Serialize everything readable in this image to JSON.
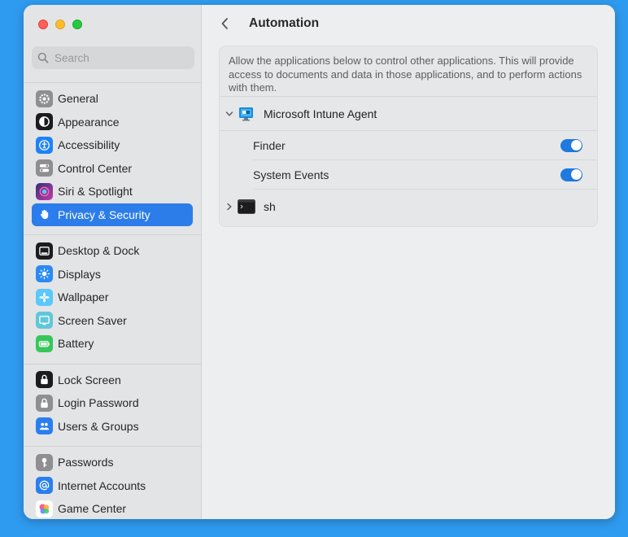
{
  "window": {
    "title": "Automation"
  },
  "search": {
    "placeholder": "Search"
  },
  "sidebar": {
    "groups": [
      [
        {
          "label": "General",
          "icon": "gear-icon",
          "color": "#8e8e93"
        },
        {
          "label": "Appearance",
          "icon": "appearance-icon",
          "color": "#1c1c1e"
        },
        {
          "label": "Accessibility",
          "icon": "accessibility-icon",
          "color": "#1e82f7"
        },
        {
          "label": "Control Center",
          "icon": "control-center-icon",
          "color": "#8e8e93"
        },
        {
          "label": "Siri & Spotlight",
          "icon": "siri-icon",
          "color": "#7a3cd6"
        },
        {
          "label": "Privacy & Security",
          "icon": "hand-icon",
          "color": "#2b7ef0",
          "active": true
        }
      ],
      [
        {
          "label": "Desktop & Dock",
          "icon": "dock-icon",
          "color": "#1c1c1e"
        },
        {
          "label": "Displays",
          "icon": "sun-icon",
          "color": "#2a8af5"
        },
        {
          "label": "Wallpaper",
          "icon": "wallpaper-icon",
          "color": "#5ac8fa"
        },
        {
          "label": "Screen Saver",
          "icon": "screen-saver-icon",
          "color": "#5fc7d9"
        },
        {
          "label": "Battery",
          "icon": "battery-icon",
          "color": "#35c759"
        }
      ],
      [
        {
          "label": "Lock Screen",
          "icon": "lock-icon",
          "color": "#1c1c1e"
        },
        {
          "label": "Login Password",
          "icon": "padlock-icon",
          "color": "#8e8e93"
        },
        {
          "label": "Users & Groups",
          "icon": "users-icon",
          "color": "#2a7ff0"
        }
      ],
      [
        {
          "label": "Passwords",
          "icon": "key-icon",
          "color": "#8e8e93"
        },
        {
          "label": "Internet Accounts",
          "icon": "at-icon",
          "color": "#2a7ff0"
        },
        {
          "label": "Game Center",
          "icon": "game-center-icon",
          "color": "#ffffff"
        }
      ]
    ]
  },
  "content": {
    "back": "<",
    "description": "Allow the applications below to control other applications. This will provide access to documents and data in those applications, and to perform actions with them.",
    "apps": [
      {
        "name": "Microsoft Intune Agent",
        "expanded": true,
        "targets": [
          {
            "label": "Finder",
            "enabled": true
          },
          {
            "label": "System Events",
            "enabled": true
          }
        ]
      },
      {
        "name": "sh",
        "expanded": false,
        "targets": []
      }
    ]
  }
}
